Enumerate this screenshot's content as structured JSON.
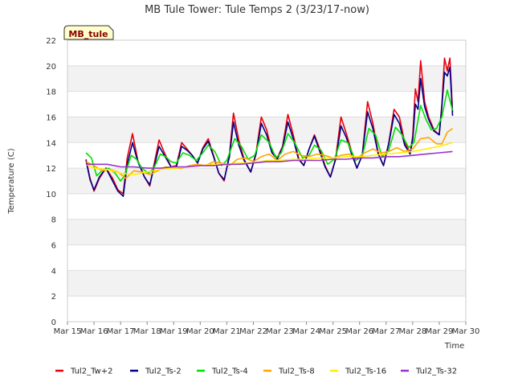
{
  "chart_data": {
    "type": "line",
    "title": "MB Tule Tower: Tule Temps 2 (3/23/17-now)",
    "xlabel": "Time",
    "ylabel": "Temperature (C)",
    "badge": "MB_tule",
    "ylim": [
      0,
      22
    ],
    "yticks": [
      0,
      2,
      4,
      6,
      8,
      10,
      12,
      14,
      16,
      18,
      20,
      22
    ],
    "xlim": [
      15,
      30
    ],
    "xticks": [
      {
        "v": 15,
        "label": "Mar 15"
      },
      {
        "v": 16,
        "label": "Mar 16"
      },
      {
        "v": 17,
        "label": "Mar 17"
      },
      {
        "v": 18,
        "label": "Mar 18"
      },
      {
        "v": 19,
        "label": "Mar 19"
      },
      {
        "v": 20,
        "label": "Mar 20"
      },
      {
        "v": 21,
        "label": "Mar 21"
      },
      {
        "v": 22,
        "label": "Mar 22"
      },
      {
        "v": 23,
        "label": "Mar 23"
      },
      {
        "v": 24,
        "label": "Mar 24"
      },
      {
        "v": 25,
        "label": "Mar 25"
      },
      {
        "v": 26,
        "label": "Mar 26"
      },
      {
        "v": 27,
        "label": "Mar 27"
      },
      {
        "v": 28,
        "label": "Mar 28"
      },
      {
        "v": 29,
        "label": "Mar 29"
      },
      {
        "v": 30,
        "label": "Mar 30"
      }
    ],
    "grid": true,
    "legend_position": "bottom",
    "series": [
      {
        "name": "Tul2_Tw+2",
        "color": "#e8000b",
        "x": [
          15.7,
          15.85,
          16.0,
          16.2,
          16.45,
          16.7,
          16.9,
          17.1,
          17.25,
          17.45,
          17.65,
          17.9,
          18.1,
          18.25,
          18.45,
          18.65,
          18.9,
          19.1,
          19.3,
          19.5,
          19.7,
          19.9,
          20.1,
          20.3,
          20.5,
          20.7,
          20.9,
          21.1,
          21.25,
          21.45,
          21.65,
          21.9,
          22.1,
          22.3,
          22.5,
          22.7,
          22.9,
          23.1,
          23.3,
          23.5,
          23.7,
          23.9,
          24.1,
          24.3,
          24.5,
          24.7,
          24.9,
          25.1,
          25.3,
          25.5,
          25.7,
          25.9,
          26.1,
          26.3,
          26.5,
          26.7,
          26.9,
          27.1,
          27.3,
          27.5,
          27.7,
          27.9,
          28.0,
          28.1,
          28.2,
          28.3,
          28.45,
          28.6,
          28.8,
          29.0,
          29.1,
          29.2,
          29.3,
          29.4,
          29.5
        ],
        "y": [
          12.7,
          11.2,
          10.2,
          11.2,
          12.0,
          11.2,
          10.3,
          10.0,
          12.8,
          14.7,
          12.6,
          11.3,
          10.6,
          12.2,
          14.2,
          13.2,
          12.1,
          12.2,
          14.0,
          13.5,
          13.0,
          12.4,
          13.6,
          14.3,
          13.0,
          11.6,
          11.0,
          13.1,
          16.3,
          14.2,
          12.7,
          11.7,
          13.2,
          16.0,
          15.0,
          13.3,
          12.8,
          13.7,
          16.2,
          14.6,
          12.8,
          12.2,
          13.5,
          14.6,
          13.5,
          12.2,
          11.3,
          12.8,
          16.0,
          14.7,
          13.3,
          12.0,
          13.0,
          17.2,
          15.5,
          13.2,
          12.2,
          14.0,
          16.6,
          16.0,
          14.0,
          13.2,
          14.5,
          18.2,
          17.2,
          20.4,
          17.2,
          16.0,
          15.0,
          14.6,
          17.0,
          20.6,
          19.6,
          20.6,
          16.4
        ]
      },
      {
        "name": "Tul2_Ts-2",
        "color": "#00008b",
        "x": [
          15.7,
          15.85,
          16.0,
          16.2,
          16.45,
          16.7,
          16.9,
          17.1,
          17.25,
          17.45,
          17.65,
          17.9,
          18.1,
          18.25,
          18.45,
          18.65,
          18.9,
          19.1,
          19.3,
          19.5,
          19.7,
          19.9,
          20.1,
          20.3,
          20.5,
          20.7,
          20.9,
          21.1,
          21.25,
          21.45,
          21.65,
          21.9,
          22.1,
          22.3,
          22.5,
          22.7,
          22.9,
          23.1,
          23.3,
          23.5,
          23.7,
          23.9,
          24.1,
          24.3,
          24.5,
          24.7,
          24.9,
          25.1,
          25.3,
          25.5,
          25.7,
          25.9,
          26.1,
          26.3,
          26.5,
          26.7,
          26.9,
          27.1,
          27.3,
          27.5,
          27.7,
          27.9,
          28.0,
          28.1,
          28.2,
          28.3,
          28.45,
          28.6,
          28.8,
          29.0,
          29.1,
          29.2,
          29.3,
          29.4,
          29.5
        ],
        "y": [
          12.6,
          11.1,
          10.3,
          11.3,
          12.0,
          11.0,
          10.2,
          9.8,
          12.3,
          14.0,
          12.5,
          11.3,
          10.7,
          12.0,
          13.7,
          13.0,
          12.1,
          12.1,
          13.7,
          13.4,
          13.0,
          12.4,
          13.5,
          14.1,
          12.9,
          11.6,
          11.1,
          12.9,
          15.6,
          13.8,
          12.6,
          11.7,
          13.1,
          15.5,
          14.6,
          13.2,
          12.7,
          13.6,
          15.6,
          14.3,
          12.7,
          12.2,
          13.5,
          14.5,
          13.3,
          12.1,
          11.3,
          12.7,
          15.3,
          14.4,
          13.1,
          12.0,
          13.0,
          16.4,
          15.1,
          13.1,
          12.2,
          13.9,
          16.2,
          15.5,
          13.8,
          13.1,
          14.2,
          17.0,
          16.6,
          19.0,
          16.8,
          15.8,
          14.9,
          14.6,
          16.8,
          19.5,
          19.2,
          19.9,
          16.1
        ]
      },
      {
        "name": "Tul2_Ts-4",
        "color": "#00e000",
        "x": [
          15.7,
          15.9,
          16.1,
          16.3,
          16.55,
          16.8,
          17.0,
          17.15,
          17.4,
          17.6,
          17.8,
          18.05,
          18.25,
          18.5,
          18.7,
          18.9,
          19.1,
          19.35,
          19.6,
          19.85,
          20.1,
          20.3,
          20.55,
          20.8,
          21.0,
          21.3,
          21.55,
          21.8,
          22.05,
          22.3,
          22.6,
          22.85,
          23.05,
          23.3,
          23.55,
          23.85,
          24.1,
          24.3,
          24.55,
          24.8,
          25.05,
          25.3,
          25.55,
          25.85,
          26.1,
          26.35,
          26.6,
          26.85,
          27.1,
          27.35,
          27.6,
          27.85,
          28.05,
          28.3,
          28.5,
          28.7,
          28.9,
          29.1,
          29.3,
          29.5
        ],
        "y": [
          13.2,
          12.8,
          11.4,
          11.8,
          12.0,
          11.6,
          11.0,
          11.4,
          13.0,
          12.7,
          12.0,
          11.6,
          12.0,
          13.1,
          12.9,
          12.5,
          12.4,
          13.2,
          13.0,
          12.6,
          13.2,
          13.8,
          13.3,
          12.2,
          12.6,
          14.3,
          13.7,
          12.7,
          13.0,
          14.6,
          14.0,
          12.8,
          13.2,
          14.7,
          14.0,
          12.8,
          13.0,
          13.8,
          13.4,
          12.3,
          12.7,
          14.2,
          14.0,
          12.6,
          12.9,
          15.1,
          14.6,
          12.9,
          13.4,
          15.2,
          14.6,
          13.6,
          14.0,
          16.9,
          15.8,
          15.0,
          15.1,
          16.0,
          18.1,
          16.5
        ]
      },
      {
        "name": "Tul2_Ts-8",
        "color": "#ffa500",
        "x": [
          15.7,
          16.0,
          16.3,
          16.6,
          16.9,
          17.2,
          17.5,
          17.8,
          18.1,
          18.4,
          18.7,
          19.0,
          19.3,
          19.6,
          19.9,
          20.2,
          20.5,
          20.8,
          21.1,
          21.4,
          21.7,
          22.0,
          22.3,
          22.6,
          22.9,
          23.2,
          23.5,
          23.8,
          24.1,
          24.4,
          24.7,
          25.0,
          25.3,
          25.6,
          25.9,
          26.2,
          26.5,
          26.8,
          27.1,
          27.4,
          27.7,
          28.0,
          28.3,
          28.6,
          28.9,
          29.1,
          29.3,
          29.5
        ],
        "y": [
          12.5,
          12.2,
          11.8,
          11.9,
          11.7,
          11.2,
          11.8,
          11.7,
          11.5,
          11.8,
          12.1,
          12.0,
          12.0,
          12.2,
          12.3,
          12.2,
          12.5,
          12.4,
          12.2,
          12.7,
          12.8,
          12.5,
          12.9,
          13.1,
          12.6,
          13.1,
          13.3,
          13.0,
          12.9,
          13.1,
          13.0,
          12.8,
          13.0,
          13.1,
          12.8,
          13.2,
          13.5,
          13.2,
          13.3,
          13.6,
          13.3,
          13.5,
          14.3,
          14.4,
          13.9,
          13.9,
          14.8,
          15.1
        ]
      },
      {
        "name": "Tul2_Ts-16",
        "color": "#ffee00",
        "x": [
          15.7,
          16.0,
          16.5,
          17.0,
          17.5,
          18.0,
          18.5,
          19.0,
          19.5,
          20.0,
          20.5,
          21.0,
          21.5,
          22.0,
          22.5,
          23.0,
          23.5,
          24.0,
          24.5,
          25.0,
          25.5,
          26.0,
          26.5,
          27.0,
          27.5,
          28.0,
          28.5,
          29.0,
          29.5
        ],
        "y": [
          12.3,
          12.0,
          11.9,
          11.6,
          11.5,
          11.7,
          11.9,
          12.0,
          12.1,
          12.2,
          12.3,
          12.3,
          12.4,
          12.4,
          12.6,
          12.6,
          12.7,
          12.7,
          12.8,
          12.8,
          12.9,
          12.9,
          13.0,
          13.1,
          13.2,
          13.3,
          13.5,
          13.7,
          14.0
        ]
      },
      {
        "name": "Tul2_Ts-32",
        "color": "#9932cc",
        "x": [
          15.7,
          16.0,
          16.5,
          17.0,
          17.5,
          18.0,
          18.5,
          19.0,
          19.5,
          20.0,
          20.5,
          21.0,
          21.5,
          22.0,
          22.5,
          23.0,
          23.5,
          24.0,
          24.5,
          25.0,
          25.5,
          26.0,
          26.5,
          27.0,
          27.5,
          28.0,
          28.5,
          29.0,
          29.5
        ],
        "y": [
          12.3,
          12.3,
          12.3,
          12.1,
          12.1,
          12.0,
          12.0,
          12.1,
          12.1,
          12.2,
          12.2,
          12.3,
          12.3,
          12.4,
          12.5,
          12.5,
          12.6,
          12.6,
          12.6,
          12.7,
          12.7,
          12.8,
          12.8,
          12.9,
          12.9,
          13.0,
          13.1,
          13.2,
          13.3
        ]
      }
    ]
  }
}
